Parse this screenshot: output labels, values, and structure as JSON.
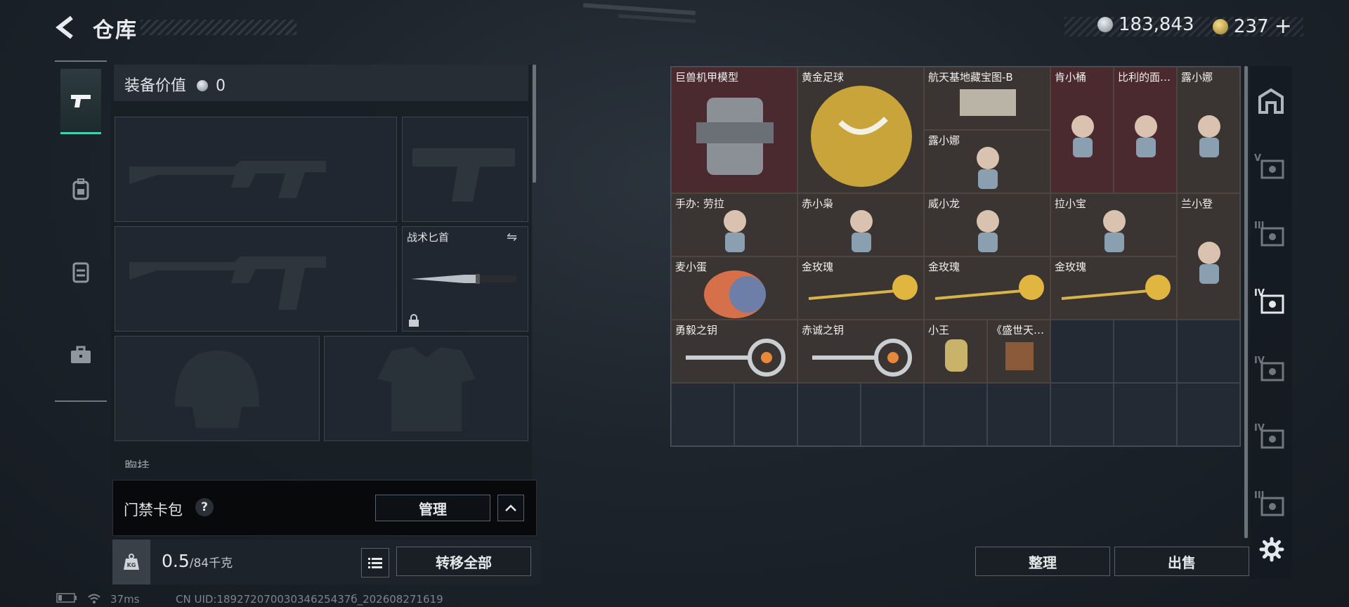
{
  "header": {
    "title": "仓库"
  },
  "currency": {
    "silver": "183,843",
    "gold": "237",
    "plus": "+"
  },
  "equipment": {
    "value_label": "装备价值",
    "value": "0",
    "knife_label": "战术匕首",
    "chest_label": "胸挂"
  },
  "card_bag": {
    "label": "门禁卡包",
    "help": "?",
    "manage": "管理"
  },
  "weight": {
    "kg_icon": "KG",
    "current": "0.5",
    "max": "/84千克",
    "transfer_all": "转移全部"
  },
  "stash_items": [
    {
      "name": "巨兽机甲模型",
      "color": "#4a2a2e"
    },
    {
      "name": "黄金足球",
      "color": "#3a3532"
    },
    {
      "name": "航天基地藏宝图-B",
      "color": "#3a3532"
    },
    {
      "name": "露小娜",
      "color": "#3a3532"
    },
    {
      "name": "肯小桶",
      "color": "#4a2a2e"
    },
    {
      "name": "比利的面…",
      "color": "#4a2a2e"
    },
    {
      "name": "露小娜",
      "color": "#3a3532"
    },
    {
      "name": "手办: 劳拉",
      "color": "#3a3532"
    },
    {
      "name": "赤小枭",
      "color": "#3a3532"
    },
    {
      "name": "威小龙",
      "color": "#3a3532"
    },
    {
      "name": "拉小宝",
      "color": "#3a3532"
    },
    {
      "name": "兰小登",
      "color": "#3a3532"
    },
    {
      "name": "麦小蛋",
      "color": "#3a3532"
    },
    {
      "name": "金玫瑰",
      "color": "#3a3532"
    },
    {
      "name": "金玫瑰",
      "color": "#3a3532"
    },
    {
      "name": "金玫瑰",
      "color": "#3a3532"
    },
    {
      "name": "勇毅之钥",
      "color": "#3a3532"
    },
    {
      "name": "赤诚之钥",
      "color": "#3a3532"
    },
    {
      "name": "小王",
      "color": "#3a3532"
    },
    {
      "name": "《盛世天…",
      "color": "#3a3532"
    }
  ],
  "stash_buttons": {
    "sort": "整理",
    "sell": "出售"
  },
  "right_tabs": [
    "home-icon",
    "V",
    "III",
    "IV",
    "IV",
    "IV",
    "III"
  ],
  "status": {
    "ping": "37ms",
    "uid": "CN UID:18927207003034625437б_202608271619"
  }
}
